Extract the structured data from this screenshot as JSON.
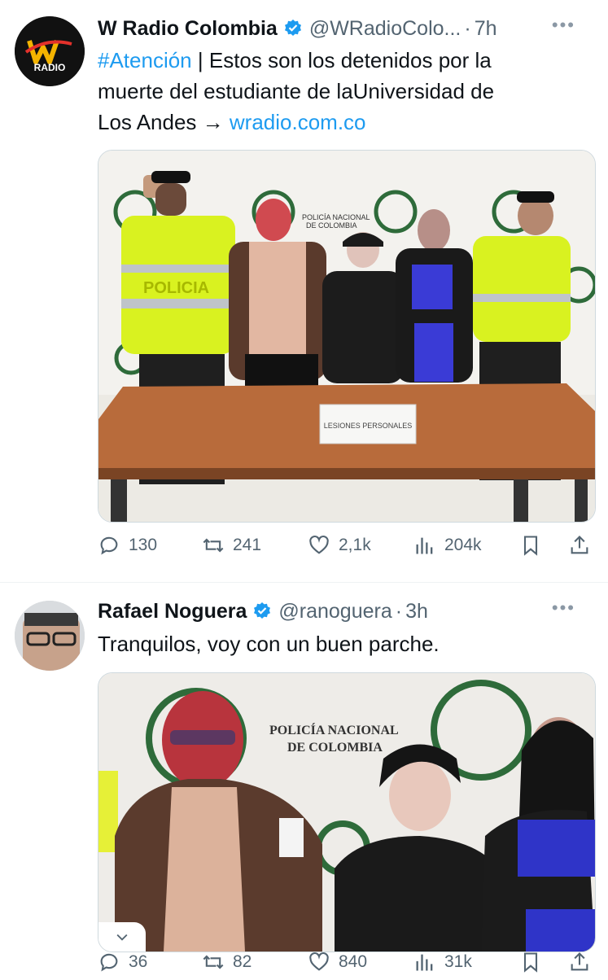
{
  "tweets": [
    {
      "display_name": "W Radio Colombia",
      "handle": "@WRadioColo...",
      "separator": "·",
      "time": "7h",
      "avatar_text": "RADIO",
      "hashtag": "#Atención",
      "text_line1_rest": " | Estos son los detenidos por la",
      "text_line2": "muerte del estudiante de laUniversidad de",
      "text_line3_start": "Los Andes → ",
      "link": "wradio.com.co",
      "media_sign": "LESIONES PERSONALES",
      "media_banner_lines": [
        "POLICÍA NACIONAL",
        "DE COLOMBIA"
      ],
      "media_vest_text": "POLICIA",
      "stats": {
        "replies": "130",
        "reposts": "241",
        "likes": "2,1k",
        "views": "204k"
      }
    },
    {
      "display_name": "Rafael Noguera",
      "handle": "@ranoguera",
      "separator": "·",
      "time": "3h",
      "text": "Tranquilos, voy con un buen parche.",
      "media_banner_lines": [
        "POLICÍA NACIONAL",
        "DE COLOMBIA"
      ],
      "stats": {
        "replies": "36",
        "reposts": "82",
        "likes": "840",
        "views": "31k"
      }
    }
  ],
  "icons": [
    "verified-icon",
    "more-icon",
    "reply-icon",
    "repost-icon",
    "like-icon",
    "views-icon",
    "bookmark-icon",
    "share-icon",
    "chevron-down-icon"
  ],
  "colors": {
    "link": "#1d9bf0",
    "muted": "#536471",
    "verified": "#1d9bf0"
  }
}
